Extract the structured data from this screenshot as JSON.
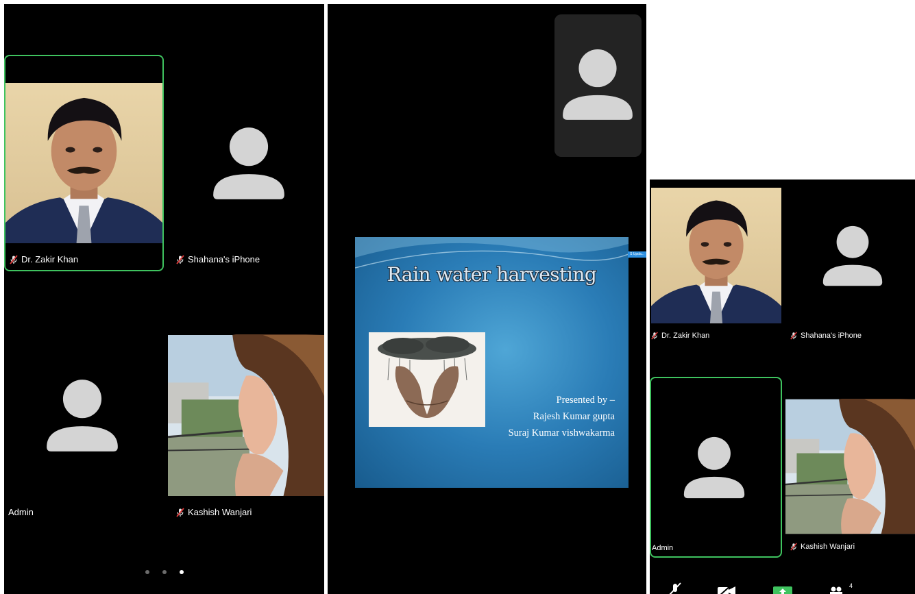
{
  "left_panel": {
    "participants": [
      {
        "name": "Dr. Zakir Khan",
        "muted": true,
        "video": true,
        "active_speaker": true
      },
      {
        "name": "Shahana's iPhone",
        "muted": true,
        "video": false
      },
      {
        "name": "Admin",
        "muted": false,
        "video": false
      },
      {
        "name": "Kashish Wanjari",
        "muted": true,
        "video": true
      }
    ],
    "page_indicator": {
      "pages": 3,
      "current": 3
    }
  },
  "center_panel": {
    "slide": {
      "title": "Rain water harvesting",
      "presented_by": "Presented by –",
      "presenters": [
        "Rajesh Kumar gupta",
        "Suraj Kumar vishwakarma"
      ]
    },
    "share_tag": "S Upda..."
  },
  "right_panel": {
    "participants": [
      {
        "name": "Dr. Zakir Khan",
        "muted": true
      },
      {
        "name": "Shahana's iPhone",
        "muted": true
      },
      {
        "name": "Admin",
        "muted": false,
        "active_speaker": true
      },
      {
        "name": "Kashish Wanjari",
        "muted": true
      }
    ],
    "toolbar": {
      "participants_count": "4"
    }
  },
  "colors": {
    "background": "#000000",
    "active_border": "#3fc35f",
    "avatar": "#d4d4d4",
    "mute_red": "#e03b3b"
  }
}
